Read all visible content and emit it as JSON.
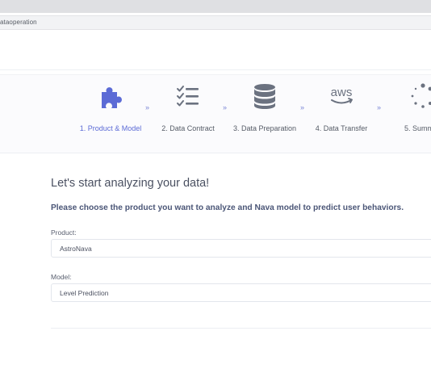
{
  "browser": {
    "url": "ataoperation"
  },
  "stepper": {
    "steps": [
      {
        "label": "1. Product & Model",
        "icon": "puzzle-icon",
        "active": true
      },
      {
        "label": "2. Data Contract",
        "icon": "checklist-icon",
        "active": false
      },
      {
        "label": "3. Data Preparation",
        "icon": "database-icon",
        "active": false
      },
      {
        "label": "4. Data Transfer",
        "icon": "aws-icon",
        "active": false
      },
      {
        "label": "5. Summ",
        "icon": "spinner-icon",
        "active": false
      }
    ],
    "separator": "»"
  },
  "main": {
    "heading": "Let's start analyzing your data!",
    "subheading": "Please choose the product you want to analyze and Nava model to predict user behaviors.",
    "product_label": "Product:",
    "product_value": "AstroNava",
    "model_label": "Model:",
    "model_value": "Level Prediction"
  },
  "colors": {
    "accent": "#5c6bd6",
    "icon_gray": "#6b7280"
  }
}
